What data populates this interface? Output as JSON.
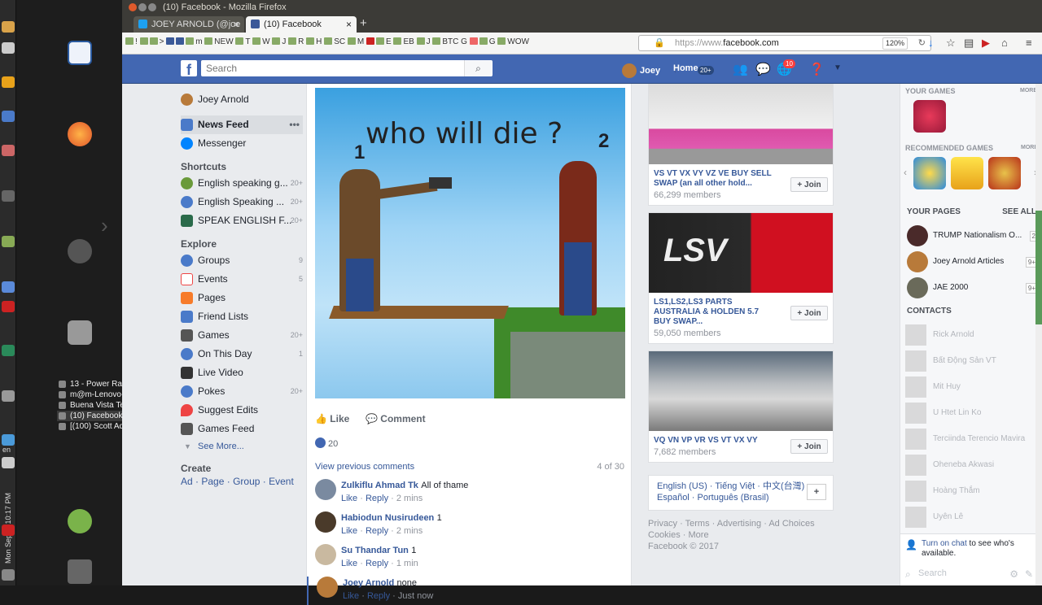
{
  "window": {
    "title": "(10) Facebook - Mozilla Firefox"
  },
  "tabs": [
    {
      "label": "JOEY ARNOLD (@joe"
    },
    {
      "label": "(10) Facebook"
    }
  ],
  "bookmarks": [
    "NEW",
    "T",
    "W",
    "J",
    "R",
    "H",
    "SC",
    "M",
    "E",
    "EB",
    "J",
    "BTC",
    "G",
    "G",
    "WOW"
  ],
  "url": {
    "prefix": "https://www.",
    "domain": "facebook.com",
    "zoom": "120%"
  },
  "taskbar": {
    "windows": [
      "13 - Power Ran...",
      "m@m-Lenovo-...",
      "Buena Vista Te...",
      "(10) Facebook -...",
      "[(100) Scott Ad..."
    ],
    "datetime": "Mon Sep 4, 10:17 PM",
    "lang": "en"
  },
  "fbbar": {
    "search_placeholder": "Search",
    "user": "Joey",
    "home": "Home",
    "home_badge": "20+",
    "notif_badge": "10"
  },
  "left": {
    "profile": "Joey Arnold",
    "news_feed": "News Feed",
    "messenger": "Messenger",
    "shortcuts_head": "Shortcuts",
    "shortcuts": [
      {
        "label": "English speaking g...",
        "count": "20+"
      },
      {
        "label": "English Speaking ...",
        "count": "20+"
      },
      {
        "label": "SPEAK ENGLISH F...",
        "count": "20+"
      }
    ],
    "explore_head": "Explore",
    "explore": [
      {
        "label": "Groups",
        "count": "9"
      },
      {
        "label": "Events",
        "count": "5"
      },
      {
        "label": "Pages",
        "count": ""
      },
      {
        "label": "Friend Lists",
        "count": ""
      },
      {
        "label": "Games",
        "count": "20+"
      },
      {
        "label": "On This Day",
        "count": "1"
      },
      {
        "label": "Live Video",
        "count": ""
      },
      {
        "label": "Pokes",
        "count": "20+"
      },
      {
        "label": "Suggest Edits",
        "count": ""
      },
      {
        "label": "Games Feed",
        "count": ""
      }
    ],
    "see_more": "See More...",
    "create_head": "Create",
    "create_links": [
      "Ad",
      "Page",
      "Group",
      "Event"
    ]
  },
  "post": {
    "image_caption": "who will die ?",
    "label1": "1",
    "label2": "2",
    "like": "Like",
    "comment": "Comment",
    "reactions": "20",
    "view_previous": "View previous comments",
    "comment_count": "4 of 30",
    "comments": [
      {
        "name": "Zulkiflu Ahmad Tk",
        "text": "All of thame",
        "time": "2 mins"
      },
      {
        "name": "Habiodun Nusirudeen",
        "text": "1",
        "time": "2 mins"
      },
      {
        "name": "Su Thandar Tun",
        "text": "1",
        "time": "1 min"
      },
      {
        "name": "Joey Arnold",
        "text": "none",
        "time": "Just now"
      }
    ],
    "like_link": "Like",
    "reply_link": "Reply"
  },
  "groups": [
    {
      "name": "VS VT VX VY VZ VE BUY SELL SWAP (an all other hold...",
      "members": "66,299 members"
    },
    {
      "name": "LS1,LS2,LS3 PARTS AUSTRALIA & HOLDEN 5.7 BUY SWAP...",
      "members": "59,050 members",
      "logo_text": "LSV"
    },
    {
      "name": "VQ VN VP VR VS VT VX VY",
      "members": "7,682 members"
    }
  ],
  "join_label": "+ Join",
  "languages": {
    "line1": "English (US) · Tiếng Việt · 中文(台灣)",
    "line2": "Español · Português (Brasil)",
    "plus": "+"
  },
  "footer": {
    "line1": "Privacy · Terms · Advertising · Ad Choices",
    "line2": "Cookies · More",
    "line3": "Facebook © 2017"
  },
  "right": {
    "your_games": "YOUR GAMES",
    "more": "MORE",
    "recommended": "RECOMMENDED GAMES",
    "your_pages": "YOUR PAGES",
    "see_all": "SEE ALL",
    "pages": [
      {
        "name": "TRUMP Nationalism O...",
        "count": "2"
      },
      {
        "name": "Joey Arnold Articles",
        "count": "9+"
      },
      {
        "name": "JAE 2000",
        "count": "9+"
      }
    ],
    "contacts_head": "CONTACTS",
    "contacts": [
      "Rick Arnold",
      "Bất Động Sản VT",
      "Mit Huy",
      "U Htet Lin Ko",
      "Terciinda Terencio Mavira",
      "Oheneba Akwasi",
      "Hoàng Thắm",
      "Uyên Lê"
    ],
    "chat_link": "Turn on chat",
    "chat_msg": " to see who's available.",
    "search": "Search"
  }
}
